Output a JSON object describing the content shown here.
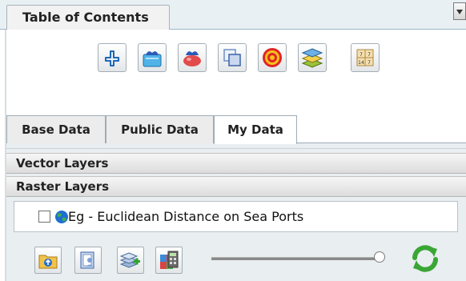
{
  "panel": {
    "title": "Table of Contents"
  },
  "toolbar": {
    "tools": [
      {
        "name": "select-tool-icon"
      },
      {
        "name": "add-layer-tool-icon"
      },
      {
        "name": "remove-layer-tool-icon"
      },
      {
        "name": "zoom-extent-tool-icon"
      },
      {
        "name": "target-tool-icon"
      },
      {
        "name": "layers-stack-tool-icon"
      },
      {
        "name": "grid-numbers-tool-icon",
        "labels": [
          "7",
          "7",
          "14",
          "7"
        ]
      }
    ]
  },
  "tabs": [
    {
      "label": "Base Data",
      "active": false
    },
    {
      "label": "Public Data",
      "active": false
    },
    {
      "label": "My Data",
      "active": true
    }
  ],
  "sections": {
    "vector": "Vector Layers",
    "raster": "Raster Layers"
  },
  "layers": [
    {
      "checked": false,
      "icon": "globe-icon",
      "label": "Eg - Euclidean Distance on Sea Ports"
    }
  ],
  "bottom_toolbar": {
    "buttons": [
      {
        "name": "import-button"
      },
      {
        "name": "library-button"
      },
      {
        "name": "add-layers-button"
      },
      {
        "name": "calculator-button"
      }
    ],
    "opacity_value": 1.0,
    "refresh_icon": "refresh-icon"
  },
  "colors": {
    "header_bg": "#e8f0f4",
    "content_bg": "#e9eef1",
    "accent_green": "#3aa635"
  }
}
